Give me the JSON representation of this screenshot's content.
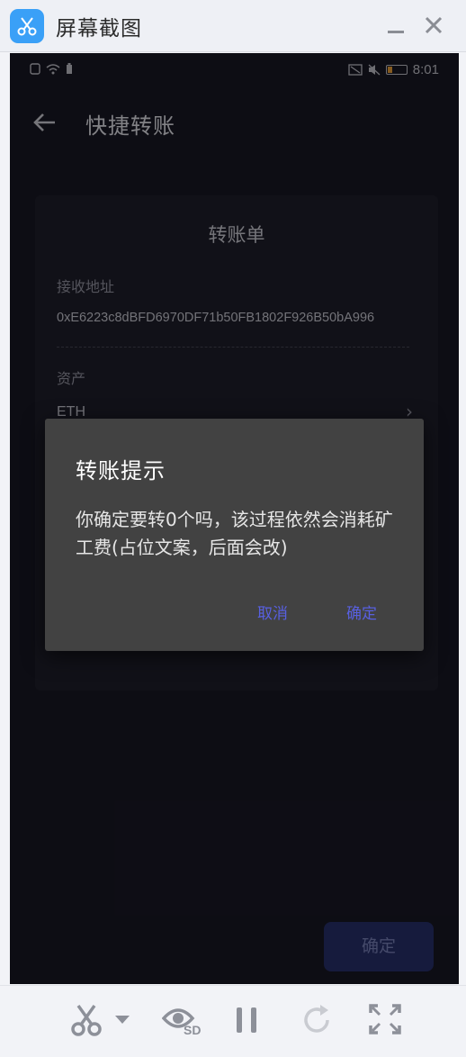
{
  "window": {
    "title": "屏幕截图",
    "minimize": "_",
    "close": "✕"
  },
  "statusbar": {
    "time": "8:01"
  },
  "appbar": {
    "title": "快捷转账"
  },
  "card": {
    "title": "转账单",
    "receive_label": "接收地址",
    "receive_value": "0xE6223c8dBFD6970DF71b50FB1802F926B50bA996",
    "asset_label": "资产",
    "asset_value": "ETH",
    "asset_chevron": "›"
  },
  "dialog": {
    "title": "转账提示",
    "message": "你确定要转0个吗，该过程依然会消耗矿工费(占位文案，后面会改)",
    "cancel": "取消",
    "ok": "确定"
  },
  "footer": {
    "confirm": "确定"
  },
  "toolbar": {
    "items": [
      "scissors-icon",
      "dropdown-icon",
      "eye-sd-icon",
      "pause-icon",
      "refresh-icon",
      "fullscreen-icon"
    ],
    "sd_label": "SD"
  },
  "colors": {
    "accent": "#5860e0",
    "phone_bg": "#191826",
    "logo": "#3aa0f7"
  }
}
